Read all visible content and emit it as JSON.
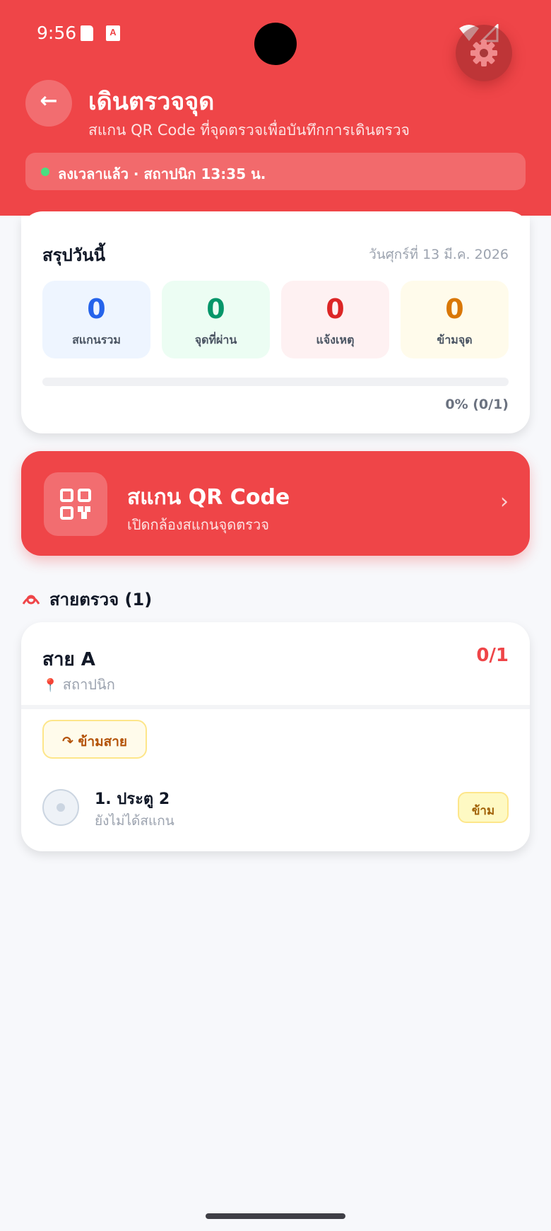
{
  "status_bar": {
    "time": "9:56",
    "notification_icons": [
      "sd-card-icon",
      "a-app-icon"
    ],
    "signal_icons": [
      "wifi-icon",
      "cellular-icon"
    ]
  },
  "header": {
    "title": "เดินตรวจจุด",
    "subtitle": "สแกน QR Code ที่จุดตรวจเพื่อบันทึกการเดินตรวจ",
    "clock_status": "ลงเวลาแล้ว · สถาปนิก 13:35 น.",
    "colors": {
      "background": "#ef4548",
      "clock_dot": "#4ade80"
    }
  },
  "summary": {
    "title": "สรุปวันนี้",
    "date": "วันศุกร์ที่ 13 มี.ค. 2026",
    "stats": [
      {
        "value": "0",
        "label": "สแกนรวม",
        "color": "#2563eb"
      },
      {
        "value": "0",
        "label": "จุดที่ผ่าน",
        "color": "#059669"
      },
      {
        "value": "0",
        "label": "แจ้งเหตุ",
        "color": "#dc2626"
      },
      {
        "value": "0",
        "label": "ข้ามจุด",
        "color": "#d97706"
      }
    ],
    "progress_percent": 0,
    "progress_text": "0% (0/1)"
  },
  "scan": {
    "title": "สแกน QR Code",
    "subtitle": "เปิดกล้องสแกนจุดตรวจ",
    "chevron": "›"
  },
  "routes": {
    "heading": "สายตรวจ (1)",
    "items": [
      {
        "name": "สาย A",
        "count": "0/1",
        "location": "สถาปนิก",
        "skip_route_label": "↷ ข้ามสาย",
        "checkpoints": [
          {
            "name": "1. ประตู 2",
            "status": "ยังไม่ได้สแกน",
            "action_label": "ข้าม"
          }
        ]
      }
    ]
  },
  "back_label": "←"
}
